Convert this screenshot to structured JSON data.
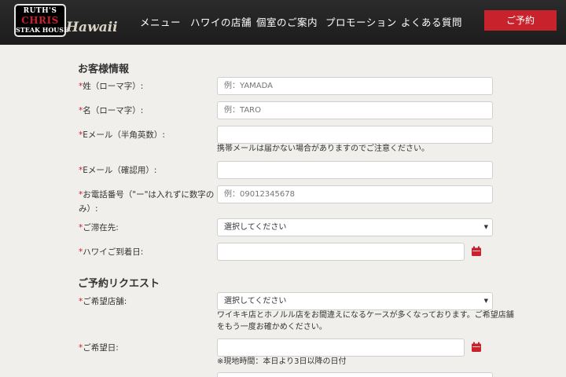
{
  "logo": {
    "line1": "RUTH'S",
    "line2": "CHRIS",
    "line3": "STEAK HOUSE",
    "script": "Hawaii"
  },
  "nav": [
    "メニュー",
    "ハワイの店舗",
    "個室のご案内",
    "プロモーション",
    "よくある質問"
  ],
  "reserve_label": "ご予約",
  "required_mark": "*",
  "sections": {
    "customer": "お客様情報",
    "request": "ご予約リクエスト"
  },
  "fields": {
    "last_name": {
      "label": "姓（ローマ字）:",
      "placeholder": "例：YAMADA"
    },
    "first_name": {
      "label": "名（ローマ字）:",
      "placeholder": "例：TARO"
    },
    "email": {
      "label": "Eメール（半角英数）:",
      "note": "携帯メールは届かない場合がありますのでご注意ください。"
    },
    "email_confirm": {
      "label": "Eメール（確認用）:"
    },
    "phone": {
      "label_line1": "お電話番号（\"ー\"は入れずに数字の",
      "label_line2": "み）:",
      "placeholder": "例：09012345678"
    },
    "stay": {
      "label": "ご滞在先:",
      "selected": "選択してください"
    },
    "arrival": {
      "label": "ハワイご到着日:"
    },
    "store": {
      "label": "ご希望店舗:",
      "selected": "選択してください",
      "note_line1": "ワイキキ店とホノルル店をお間違えになるケースが多くなっております。ご希望店舗",
      "note_line2": "をもう一度お確かめください。"
    },
    "date": {
      "label": "ご希望日:",
      "note": "※現地時間：本日より3日以降の日付"
    }
  },
  "colors": {
    "accent": "#c8232c",
    "header_bg": "#222222",
    "page_bg": "#f0efec"
  }
}
